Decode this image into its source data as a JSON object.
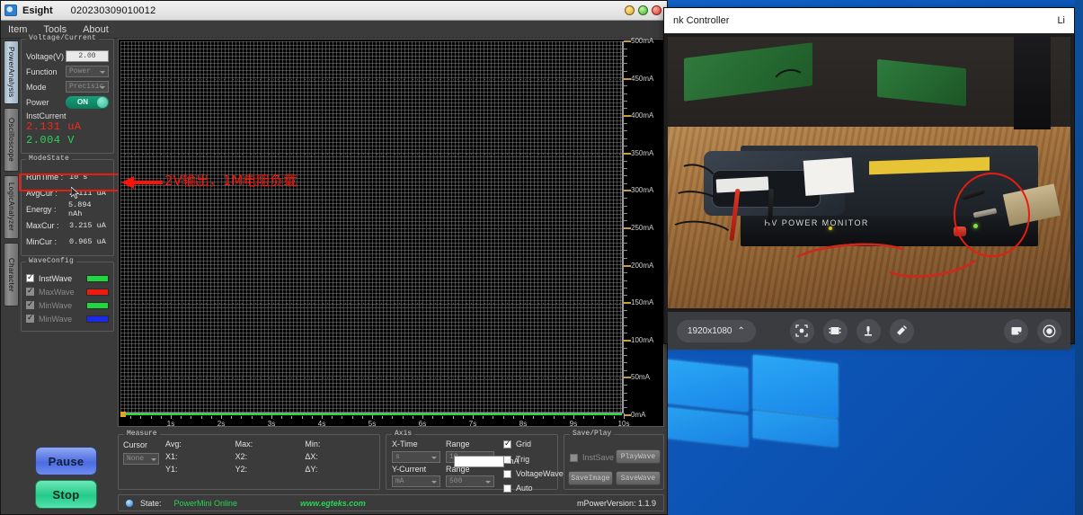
{
  "app": {
    "title": "Esight",
    "serial": "020230309010012",
    "menu": [
      "Item",
      "Tools",
      "About"
    ],
    "window_buttons": [
      "minimize-button",
      "maximize-button",
      "close-button"
    ]
  },
  "tabs": [
    {
      "label": "PowerAnalysis",
      "active": true
    },
    {
      "label": "Oscilloscope",
      "active": false
    },
    {
      "label": "LogicAnalyzer",
      "active": false
    },
    {
      "label": "Character",
      "active": false
    }
  ],
  "voltage_current": {
    "legend": "Voltage/Current",
    "voltage_label": "Voltage(V)",
    "voltage_value": "2.00",
    "function_label": "Function",
    "function_value": "Power",
    "mode_label": "Mode",
    "mode_value": "Precisic",
    "power_label": "Power",
    "power_state": "ON",
    "inst_current_label": "InstCurrent",
    "inst_current": "2.131 uA",
    "inst_voltage": "2.004 V",
    "current_color": "#ee2b1e",
    "voltage_color": "#27d654"
  },
  "mode_state": {
    "legend": "ModeState",
    "rows": [
      {
        "key": "RunTime :",
        "value": "10 s"
      },
      {
        "key": "AvgCur :",
        "value": "2.111 uA"
      },
      {
        "key": "Energy :",
        "value": "5.894 nAh"
      },
      {
        "key": "MaxCur :",
        "value": "3.215 uA"
      },
      {
        "key": "MinCur :",
        "value": "0.965 uA"
      }
    ]
  },
  "wave_config": {
    "legend": "WaveConfig",
    "items": [
      {
        "label": "InstWave",
        "checked": true,
        "enabled": true,
        "color": "#1fd83f"
      },
      {
        "label": "MaxWave",
        "checked": true,
        "enabled": false,
        "color": "#ee1b10"
      },
      {
        "label": "MinWave",
        "checked": true,
        "enabled": false,
        "color": "#1fd83f"
      },
      {
        "label": "MinWave",
        "checked": true,
        "enabled": false,
        "color": "#1a2ae8"
      }
    ]
  },
  "transport": {
    "pause_label": "Pause",
    "stop_label": "Stop"
  },
  "annotation": {
    "text": "2V输出，1M电阻负载",
    "color": "#fb1305"
  },
  "chart_data": {
    "type": "line",
    "title": "",
    "xlabel": "",
    "ylabel": "",
    "x_tick_labels": [
      "1s",
      "2s",
      "3s",
      "4s",
      "5s",
      "6s",
      "7s",
      "8s",
      "9s",
      "10s"
    ],
    "x": [
      1,
      2,
      3,
      4,
      5,
      6,
      7,
      8,
      9,
      10
    ],
    "xlim": [
      0,
      10
    ],
    "y_tick_labels": [
      "0mA",
      "50mA",
      "100mA",
      "150mA",
      "200mA",
      "250mA",
      "300mA",
      "350mA",
      "400mA",
      "450mA",
      "500mA"
    ],
    "y_ticks": [
      0,
      50,
      100,
      150,
      200,
      250,
      300,
      350,
      400,
      450,
      500
    ],
    "ylim": [
      0,
      500
    ],
    "grid": true,
    "background": "#000000",
    "series": [
      {
        "name": "InstWave",
        "color": "#27d83f",
        "values": [
          0.0021,
          0.0021,
          0.0021,
          0.0021,
          0.0021,
          0.0021,
          0.0021,
          0.0021,
          0.0021,
          0.0021
        ]
      }
    ]
  },
  "measure": {
    "legend": "Measure",
    "cursor_label": "Cursor",
    "cursor_value": "None",
    "cells": [
      "Avg:",
      "Max:",
      "Min:",
      "X1:",
      "X2:",
      "ΔX:",
      "Y1:",
      "Y2:",
      "ΔY:"
    ]
  },
  "axis": {
    "legend": "Axis",
    "xtime_label": "X-Time",
    "xtime_unit": "s",
    "xrange_label": "Range",
    "xrange_value": "10",
    "ycurrent_label": "Y-Current",
    "ycurrent_unit": "mA",
    "yrange_label": "Range",
    "yrange_value": "500",
    "grid_label": "Grid",
    "grid_checked": true,
    "trig_label": "Trig",
    "trig_checked": false,
    "trig_value": "",
    "trig_unit": "mA",
    "voltagewave_label": "VoltageWave",
    "voltagewave_checked": false,
    "auto_label": "Auto",
    "auto_checked": false
  },
  "save_play": {
    "legend": "Save/Play",
    "instsave_label": "InstSave",
    "instsave_checked": false,
    "playwave_label": "PlayWave",
    "saveimage_label": "SaveImage",
    "savewave_label": "SaveWave"
  },
  "status": {
    "state_label": "State:",
    "state_value": "PowerMini Online",
    "url": "www.egteks.com",
    "version": "mPowerVersion: 1.1.9"
  },
  "video_window": {
    "title": "nk Controller",
    "title_right": "Li",
    "resolution": "1920x1080",
    "resolution_caret": "⌃",
    "toolbar_icons": [
      "focus-frame-icon",
      "film-strip-icon",
      "microscope-icon",
      "measure-tool-icon",
      "snapshot-icon",
      "record-icon"
    ],
    "scene_label": "HV POWER MONITOR"
  }
}
